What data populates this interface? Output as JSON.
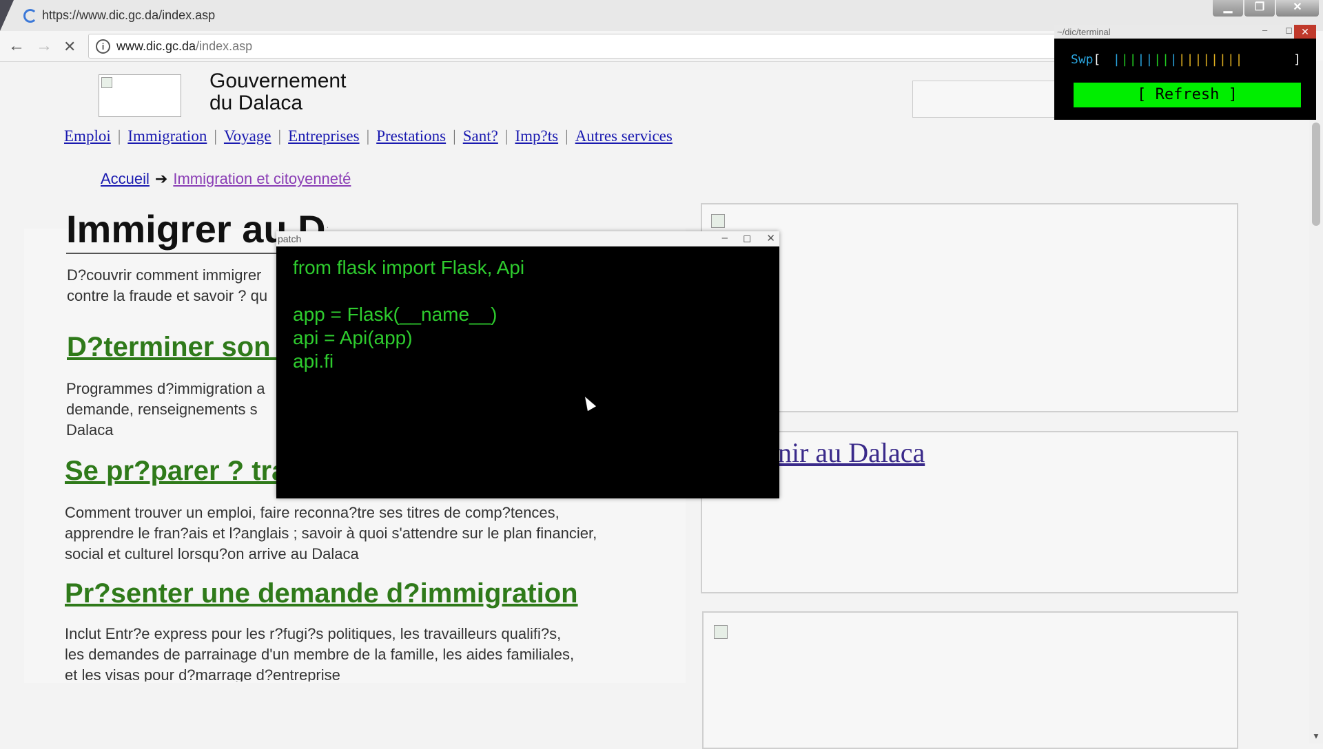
{
  "browser": {
    "tab_url": "https://www.dic.gc.da/index.asp",
    "address_host": "www.dic.gc.da",
    "address_path": "/index.asp",
    "back_icon": "←",
    "forward_icon": "→",
    "stop_icon": "✕",
    "info_icon": "i"
  },
  "site": {
    "gov_title_line1": "Gouvernement",
    "gov_title_line2": "du Dalaca",
    "nav": [
      "Emploi",
      "Immigration",
      "Voyage",
      "Entreprises",
      "Prestations",
      "Sant?",
      "Imp?ts",
      "Autres services"
    ],
    "nav_sep": "|",
    "breadcrumb": {
      "home": "Accueil",
      "arrow": "➔",
      "current": "Immigration et citoyenneté"
    }
  },
  "content": {
    "heading": "Immigrer au Dalaca",
    "intro_line1": "D?couvrir comment immigrer",
    "intro_line2": "contre la fraude et savoir ? qu",
    "sections": [
      {
        "title": "D?terminer son a",
        "text_lines": [
          "Programmes d?immigration a",
          "demande, renseignements s",
          "Dalaca"
        ]
      },
      {
        "title": "Se pr?parer ? tra",
        "text_lines": [
          "Comment trouver un emploi, faire reconna?tre ses titres de comp?tences,",
          "apprendre le fran?ais et l?anglais ; savoir à quoi s'attendre sur le plan financier,",
          "social et culturel lorsqu?on arrive au Dalaca"
        ]
      },
      {
        "title": "Pr?senter une demande d?immigration",
        "text_lines": [
          "Inclut Entr?e express pour les r?fugi?s politiques, les travailleurs qualifi?s,",
          "les demandes de parrainage d'un membre de la famille, les aides familiales,",
          "et les visas pour d?marrage d?entreprise"
        ]
      }
    ]
  },
  "sidebar": {
    "card2_link": "nir au Dalaca"
  },
  "patch_window": {
    "title": "patch",
    "minimize": "–",
    "maximize": "◻",
    "close": "✕",
    "code": "from flask import Flask, Api\n\napp = Flask(__name__)\napi = Api(app)\napi.fi"
  },
  "terminal_window": {
    "title": "~/dic/terminal",
    "minimize": "–",
    "maximize": "◻",
    "close": "✕",
    "swp_label": "Swp",
    "swp_open": "[",
    "swp_close": "]",
    "refresh_label": "[ Refresh ]",
    "bar_colors": [
      "#2aa6e0",
      "#22cc22",
      "#22cc22",
      "#2aa6e0",
      "#2aa6e0",
      "#22cc22",
      "#22cc22",
      "#2aa6e0",
      "#e0b020",
      "#e0b020",
      "#e0b020",
      "#e0b020",
      "#e0b020",
      "#e0b020",
      "#e0b020",
      "#e0b020"
    ]
  },
  "colors": {
    "link": "#1a1ab0",
    "visited": "#8a3db5",
    "section_heading": "#2f7a1a",
    "terminal_green": "#00ee00",
    "code_green": "#2ecc2e"
  }
}
